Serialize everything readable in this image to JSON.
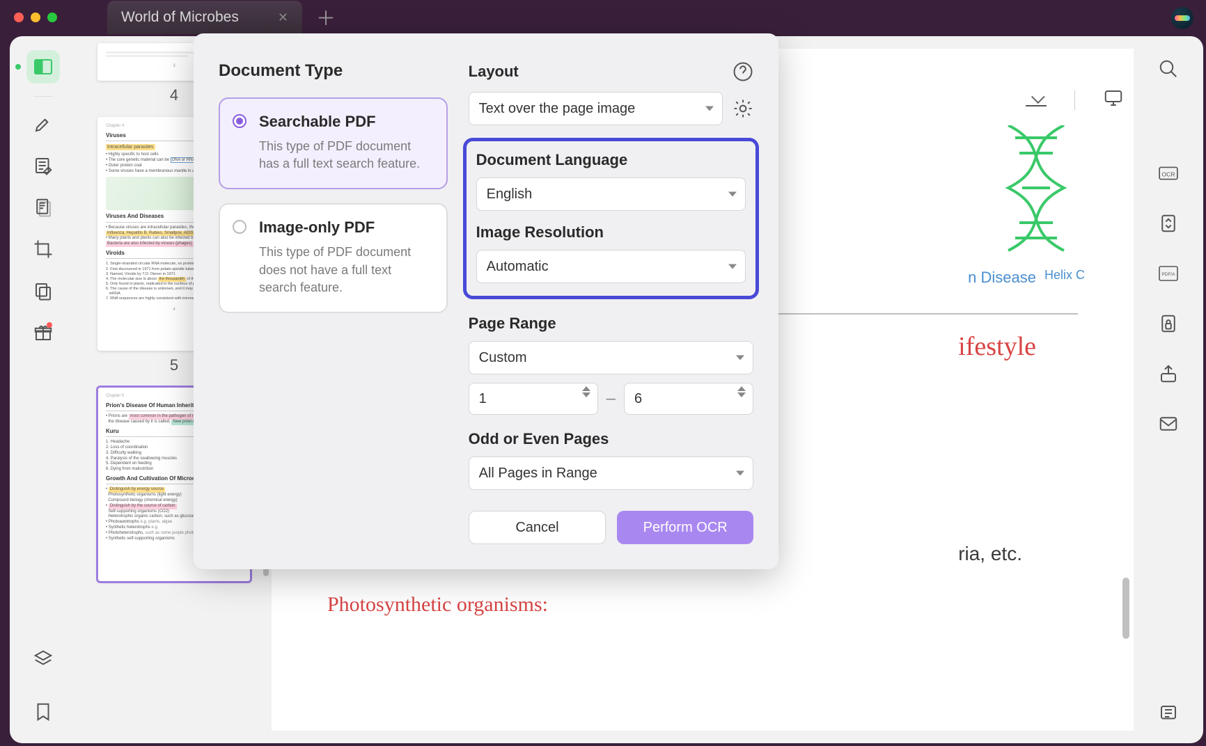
{
  "window": {
    "tab_title": "World of Microbes"
  },
  "thumbnails": {
    "pages": [
      {
        "num": "4"
      },
      {
        "num": "5",
        "h1": "Viruses",
        "h2": "Viruses And Diseases",
        "h3": "Viroids"
      },
      {
        "num": "",
        "h1": "Prion's Disease Of Human Inheritance",
        "h2": "Kuru",
        "h3": "Growth And Cultivation Of Microorg"
      }
    ]
  },
  "document": {
    "helix_label": "Helix C",
    "disease_label": "n Disease",
    "lifestyle_heading": "ifestyle",
    "line1": "ria, etc.",
    "subhead": "Photosynthetic organisms:"
  },
  "dialog": {
    "doc_type_title": "Document Type",
    "searchable": {
      "title": "Searchable PDF",
      "desc": "This type of PDF document has a full text search feature."
    },
    "image_only": {
      "title": "Image-only PDF",
      "desc": "This type of PDF document does not have a full text search feature."
    },
    "layout_label": "Layout",
    "layout_value": "Text over the page image",
    "lang_label": "Document Language",
    "lang_value": "English",
    "res_label": "Image Resolution",
    "res_value": "Automatic",
    "range_label": "Page Range",
    "range_value": "Custom",
    "range_from": "1",
    "range_to": "6",
    "odd_even_label": "Odd or Even Pages",
    "odd_even_value": "All Pages in Range",
    "cancel": "Cancel",
    "perform": "Perform OCR"
  },
  "right_tools": {
    "ocr": "OCR",
    "pdfa": "PDF/A"
  }
}
